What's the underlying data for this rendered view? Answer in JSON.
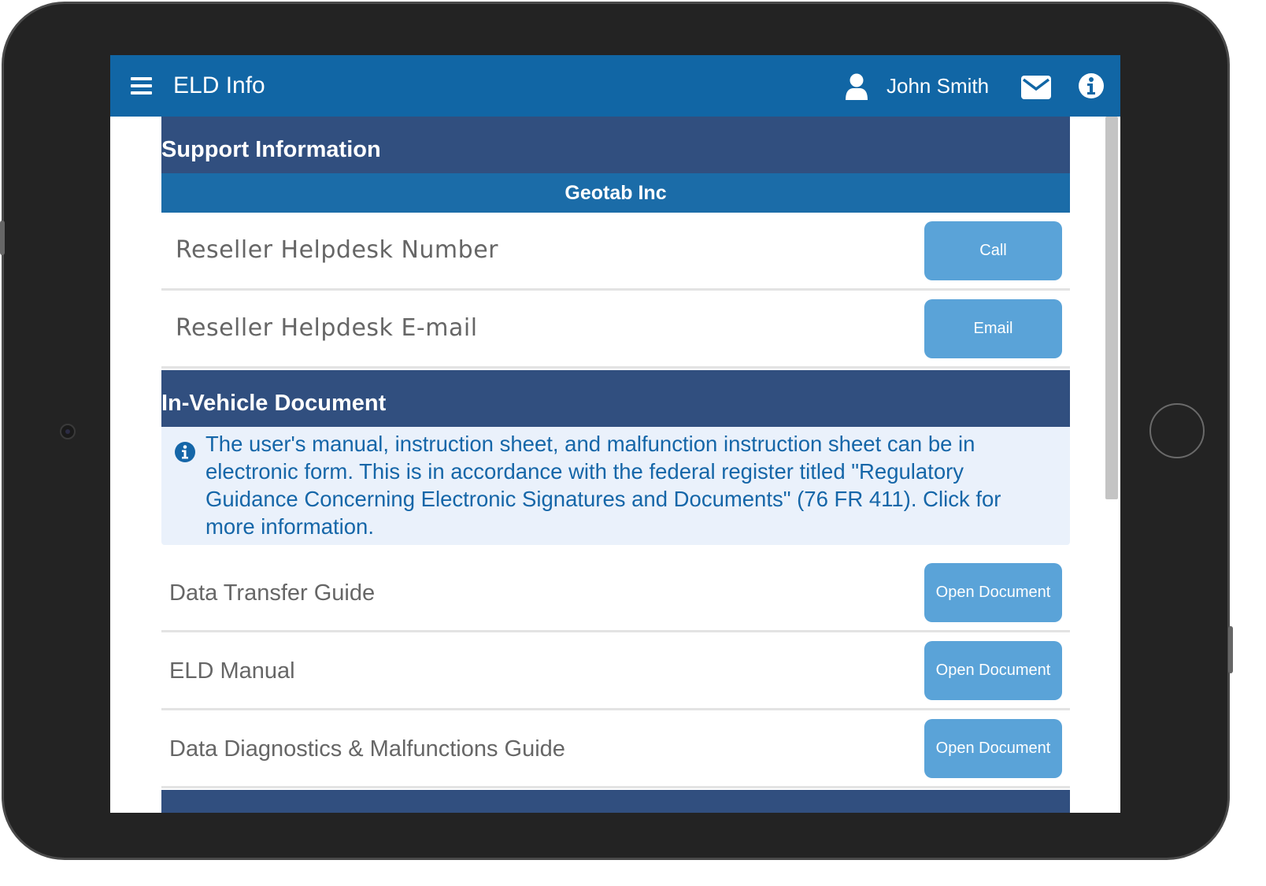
{
  "header": {
    "title": "ELD Info",
    "user_name": "John Smith",
    "icons": [
      "menu-icon",
      "user-icon",
      "mail-icon",
      "info-icon"
    ],
    "background_color": "#1166a5"
  },
  "support": {
    "heading": "Support Information",
    "company": "Geotab Inc",
    "rows": [
      {
        "label": "Reseller Helpdesk Number",
        "button": "Call"
      },
      {
        "label": "Reseller Helpdesk E-mail",
        "button": "Email"
      }
    ]
  },
  "in_vehicle": {
    "heading": "In-Vehicle Document",
    "notice": "The user's manual, instruction sheet, and malfunction instruction sheet can be in electronic form. This is in accordance with the federal register titled \"Regulatory Guidance Concerning Electronic Signatures and Documents\" (76 FR 411). Click for more information.",
    "documents": [
      {
        "label": "Data Transfer Guide",
        "button": "Open Document"
      },
      {
        "label": "ELD Manual",
        "button": "Open Document"
      },
      {
        "label": "Data Diagnostics & Malfunctions Guide",
        "button": "Open Document"
      }
    ]
  },
  "colors": {
    "section_header": "#314f7f",
    "subheader": "#1b6ca8",
    "button": "#5aa3d8",
    "notice_bg": "#eaf1fb",
    "notice_text": "#1566a8"
  }
}
